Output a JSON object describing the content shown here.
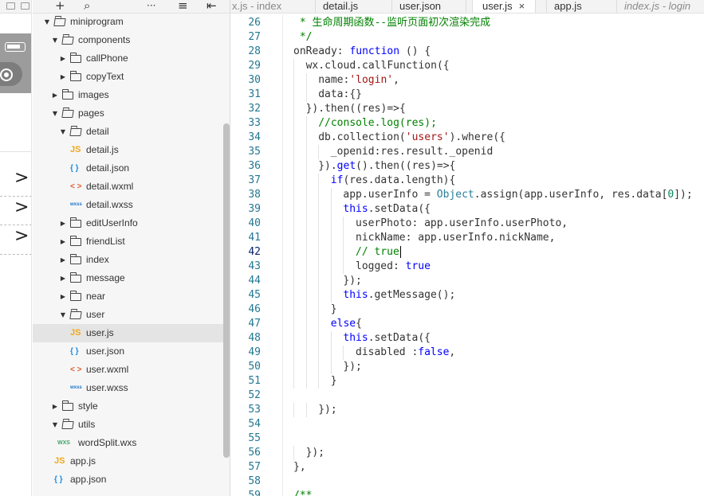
{
  "colors": {
    "comment": "#008000",
    "keyword": "#0000ff",
    "string": "#a31515",
    "number": "#098658",
    "class": "#267f99",
    "line_number": "#237893",
    "selected_row": "#e4e4e4"
  },
  "explorer": {
    "toolbar": {
      "add_icon": "+",
      "search_icon": "⌕",
      "more_icon": "···",
      "sort_icon": "≡",
      "collapse_icon": "⇤"
    },
    "tree": [
      {
        "label": "miniprogram",
        "kind": "folder",
        "depth": 0,
        "open": true
      },
      {
        "label": "components",
        "kind": "folder",
        "depth": 1,
        "open": true
      },
      {
        "label": "callPhone",
        "kind": "folder",
        "depth": 2,
        "open": false
      },
      {
        "label": "copyText",
        "kind": "folder",
        "depth": 2,
        "open": false
      },
      {
        "label": "images",
        "kind": "folder",
        "depth": 1,
        "open": false
      },
      {
        "label": "pages",
        "kind": "folder",
        "depth": 1,
        "open": true
      },
      {
        "label": "detail",
        "kind": "folder",
        "depth": 2,
        "open": true
      },
      {
        "label": "detail.js",
        "kind": "js",
        "depth": 3
      },
      {
        "label": "detail.json",
        "kind": "json",
        "depth": 3
      },
      {
        "label": "detail.wxml",
        "kind": "wxml",
        "depth": 3
      },
      {
        "label": "detail.wxss",
        "kind": "wxss",
        "depth": 3
      },
      {
        "label": "editUserInfo",
        "kind": "folder",
        "depth": 2,
        "open": false
      },
      {
        "label": "friendList",
        "kind": "folder",
        "depth": 2,
        "open": false
      },
      {
        "label": "index",
        "kind": "folder",
        "depth": 2,
        "open": false
      },
      {
        "label": "message",
        "kind": "folder",
        "depth": 2,
        "open": false
      },
      {
        "label": "near",
        "kind": "folder",
        "depth": 2,
        "open": false
      },
      {
        "label": "user",
        "kind": "folder",
        "depth": 2,
        "open": true
      },
      {
        "label": "user.js",
        "kind": "js",
        "depth": 3,
        "selected": true
      },
      {
        "label": "user.json",
        "kind": "json",
        "depth": 3
      },
      {
        "label": "user.wxml",
        "kind": "wxml",
        "depth": 3
      },
      {
        "label": "user.wxss",
        "kind": "wxss",
        "depth": 3
      },
      {
        "label": "style",
        "kind": "folder",
        "depth": 1,
        "open": false
      },
      {
        "label": "utils",
        "kind": "folder",
        "depth": 1,
        "open": true
      },
      {
        "label": "wordSplit.wxs",
        "kind": "wxs",
        "depth": 2
      },
      {
        "label": "app.js",
        "kind": "js",
        "depth": 1
      },
      {
        "label": "app.json",
        "kind": "json",
        "depth": 1
      }
    ],
    "icon_glyphs": {
      "js": "JS",
      "json": "{ }",
      "wxml": "< >",
      "wxss": "wxss",
      "wxs": "WXS"
    }
  },
  "tabs": [
    {
      "label": "x.js - index",
      "dim": true,
      "italic": false,
      "active": false
    },
    {
      "label": "detail.js",
      "dim": false,
      "italic": false,
      "active": false
    },
    {
      "label": "user.json",
      "dim": false,
      "italic": false,
      "active": false
    },
    {
      "label": "user.js",
      "dim": false,
      "italic": false,
      "active": true,
      "close": "×"
    },
    {
      "label": "app.js",
      "dim": false,
      "italic": false,
      "active": false
    },
    {
      "label": "index.js - login",
      "dim": true,
      "italic": true,
      "active": false
    }
  ],
  "editor": {
    "current_line": 42,
    "lines": [
      {
        "n": "26",
        "indent": 0,
        "tokens": [
          [
            " * 生命周期函数--监听页面初次渲染完成",
            "cm"
          ]
        ]
      },
      {
        "n": "27",
        "indent": 0,
        "tokens": [
          [
            " */",
            "cm"
          ]
        ]
      },
      {
        "n": "28",
        "indent": 0,
        "tokens": [
          [
            "onReady: ",
            "plain"
          ],
          [
            "function",
            "kw"
          ],
          [
            " () {",
            "plain"
          ]
        ]
      },
      {
        "n": "29",
        "indent": 1,
        "tokens": [
          [
            "wx.cloud.callFunction({",
            "plain"
          ]
        ]
      },
      {
        "n": "30",
        "indent": 2,
        "tokens": [
          [
            "name:",
            "plain"
          ],
          [
            "'login'",
            "str"
          ],
          [
            ",",
            "plain"
          ]
        ]
      },
      {
        "n": "31",
        "indent": 2,
        "tokens": [
          [
            "data:{}",
            "plain"
          ]
        ]
      },
      {
        "n": "32",
        "indent": 1,
        "tokens": [
          [
            "}).then((res)=>{",
            "plain"
          ]
        ]
      },
      {
        "n": "33",
        "indent": 2,
        "tokens": [
          [
            "//console.log(res);",
            "cm"
          ]
        ]
      },
      {
        "n": "34",
        "indent": 2,
        "tokens": [
          [
            "db.collection(",
            "plain"
          ],
          [
            "'users'",
            "str"
          ],
          [
            ").where({",
            "plain"
          ]
        ]
      },
      {
        "n": "35",
        "indent": 3,
        "tokens": [
          [
            "_openid:res.result._openid",
            "plain"
          ]
        ]
      },
      {
        "n": "36",
        "indent": 2,
        "tokens": [
          [
            "}).",
            "plain"
          ],
          [
            "get",
            "kw"
          ],
          [
            "().then((res)=>{",
            "plain"
          ]
        ]
      },
      {
        "n": "37",
        "indent": 3,
        "tokens": [
          [
            "if",
            "kw"
          ],
          [
            "(res.data.length){",
            "plain"
          ]
        ]
      },
      {
        "n": "38",
        "indent": 4,
        "tokens": [
          [
            "app.userInfo = ",
            "plain"
          ],
          [
            "Object",
            "cls"
          ],
          [
            ".assign(app.userInfo, res.data[",
            "plain"
          ],
          [
            "0",
            "num"
          ],
          [
            "]);",
            "plain"
          ]
        ]
      },
      {
        "n": "39",
        "indent": 4,
        "tokens": [
          [
            "this",
            "kw"
          ],
          [
            ".setData({",
            "plain"
          ]
        ]
      },
      {
        "n": "40",
        "indent": 5,
        "tokens": [
          [
            "userPhoto: app.userInfo.userPhoto,",
            "plain"
          ]
        ]
      },
      {
        "n": "41",
        "indent": 5,
        "tokens": [
          [
            "nickName: app.userInfo.nickName,",
            "plain"
          ]
        ]
      },
      {
        "n": "42",
        "indent": 5,
        "tokens": [
          [
            "// true",
            "cm"
          ]
        ],
        "caret": true
      },
      {
        "n": "43",
        "indent": 5,
        "tokens": [
          [
            "logged: ",
            "plain"
          ],
          [
            "true",
            "kw"
          ]
        ]
      },
      {
        "n": "44",
        "indent": 4,
        "tokens": [
          [
            "});",
            "plain"
          ]
        ]
      },
      {
        "n": "45",
        "indent": 4,
        "tokens": [
          [
            "this",
            "kw"
          ],
          [
            ".getMessage();",
            "plain"
          ]
        ]
      },
      {
        "n": "46",
        "indent": 3,
        "tokens": [
          [
            "}",
            "plain"
          ]
        ]
      },
      {
        "n": "47",
        "indent": 3,
        "tokens": [
          [
            "else",
            "kw"
          ],
          [
            "{",
            "plain"
          ]
        ]
      },
      {
        "n": "48",
        "indent": 4,
        "tokens": [
          [
            "this",
            "kw"
          ],
          [
            ".setData({",
            "plain"
          ]
        ]
      },
      {
        "n": "49",
        "indent": 5,
        "tokens": [
          [
            "disabled :",
            "plain"
          ],
          [
            "false",
            "kw"
          ],
          [
            ",",
            "plain"
          ]
        ]
      },
      {
        "n": "50",
        "indent": 4,
        "tokens": [
          [
            "});",
            "plain"
          ]
        ]
      },
      {
        "n": "51",
        "indent": 3,
        "tokens": [
          [
            "}",
            "plain"
          ]
        ]
      },
      {
        "n": "52",
        "indent": 0,
        "tokens": []
      },
      {
        "n": "53",
        "indent": 2,
        "tokens": [
          [
            "});",
            "plain"
          ]
        ]
      },
      {
        "n": "54",
        "indent": 0,
        "tokens": []
      },
      {
        "n": "55",
        "indent": 0,
        "tokens": []
      },
      {
        "n": "56",
        "indent": 1,
        "tokens": [
          [
            "});",
            "plain"
          ]
        ]
      },
      {
        "n": "57",
        "indent": 0,
        "tokens": [
          [
            "},",
            "plain"
          ]
        ]
      },
      {
        "n": "58",
        "indent": 0,
        "tokens": []
      },
      {
        "n": "59",
        "indent": 0,
        "tokens": [
          [
            "/**",
            "cm"
          ]
        ]
      }
    ]
  },
  "simulator": {
    "chevrons": [
      ">",
      ">",
      ">"
    ]
  }
}
